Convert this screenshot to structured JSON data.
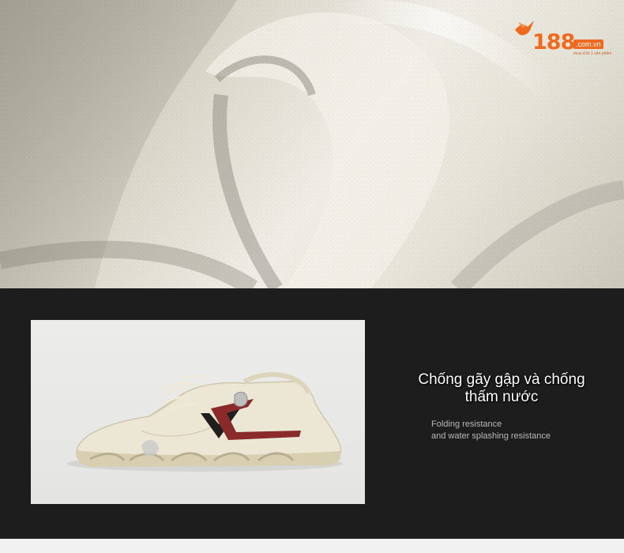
{
  "logo": {
    "number": "188",
    "domain": ".com.vn",
    "tagline": "mua sỉ từ 1 sản phẩm"
  },
  "feature": {
    "title": "Chống gãy gập và chống thấm nước",
    "subtitle_line1": "Folding resistance",
    "subtitle_line2": "and water splashing resistance"
  },
  "colors": {
    "brand_orange": "#ee6a1f",
    "dark_background": "#1d1d1d",
    "leather_cream": "#e6e3d8",
    "stripe_red": "#8a2a2a"
  },
  "icons": [
    "bird-logo-icon"
  ]
}
